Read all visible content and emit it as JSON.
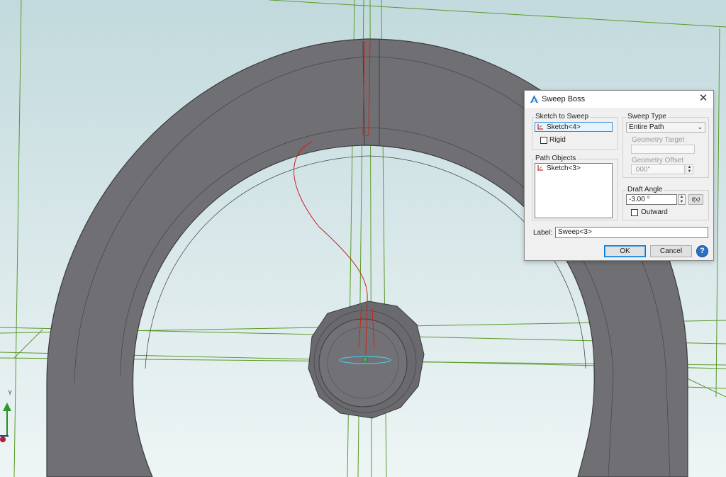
{
  "viewport": {
    "axis_label": "Y",
    "colors": {
      "model": "#6e6e72",
      "sketch_red": "#c8241a",
      "grid_green": "#5a9a2a",
      "select_cyan": "#4ec6e6"
    }
  },
  "dialog": {
    "title": "Sweep Boss",
    "close_icon": "close-icon",
    "sketch_to_sweep": {
      "label": "Sketch to Sweep",
      "value": "Sketch<4>",
      "icon": "sketch-icon"
    },
    "rigid": {
      "label": "Rigid",
      "checked": false
    },
    "path_objects": {
      "label": "Path Objects",
      "items": [
        "Sketch<3>"
      ]
    },
    "sweep_type": {
      "label": "Sweep Type",
      "value": "Entire Path"
    },
    "geometry_target": {
      "label": "Geometry Target",
      "value": ""
    },
    "geometry_offset": {
      "label": "Geometry Offset",
      "value": ".000''"
    },
    "draft_angle": {
      "label": "Draft Angle",
      "value": "-3.00 °",
      "fx_label": "f(x)"
    },
    "outward": {
      "label": "Outward",
      "checked": false
    },
    "name_label": "Label:",
    "name_value": "Sweep<3>",
    "ok_label": "OK",
    "cancel_label": "Cancel",
    "help_icon": "help-icon"
  }
}
